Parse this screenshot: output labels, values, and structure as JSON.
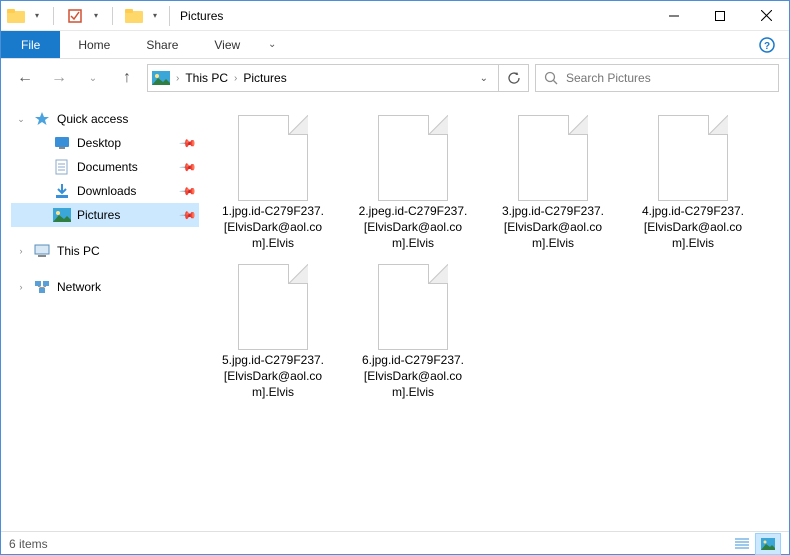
{
  "window": {
    "title": "Pictures"
  },
  "ribbon": {
    "file": "File",
    "tabs": [
      "Home",
      "Share",
      "View"
    ]
  },
  "breadcrumb": {
    "segments": [
      "This PC",
      "Pictures"
    ]
  },
  "search": {
    "placeholder": "Search Pictures"
  },
  "sidebar": {
    "quick_access": "Quick access",
    "items": [
      {
        "label": "Desktop",
        "icon": "desktop",
        "pinned": true
      },
      {
        "label": "Documents",
        "icon": "documents",
        "pinned": true
      },
      {
        "label": "Downloads",
        "icon": "downloads",
        "pinned": true
      },
      {
        "label": "Pictures",
        "icon": "pictures",
        "pinned": true,
        "selected": true
      }
    ],
    "this_pc": "This PC",
    "network": "Network"
  },
  "files": [
    {
      "name": "1.jpg.id-C279F237.[ElvisDark@aol.com].Elvis"
    },
    {
      "name": "2.jpeg.id-C279F237.[ElvisDark@aol.com].Elvis"
    },
    {
      "name": "3.jpg.id-C279F237.[ElvisDark@aol.com].Elvis"
    },
    {
      "name": "4.jpg.id-C279F237.[ElvisDark@aol.com].Elvis"
    },
    {
      "name": "5.jpg.id-C279F237.[ElvisDark@aol.com].Elvis"
    },
    {
      "name": "6.jpg.id-C279F237.[ElvisDark@aol.com].Elvis"
    }
  ],
  "status": {
    "count_label": "6 items"
  }
}
